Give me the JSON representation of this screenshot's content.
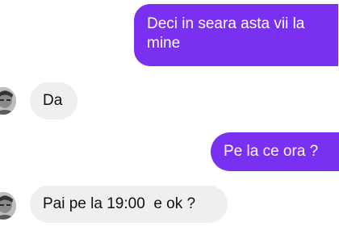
{
  "messages": [
    {
      "direction": "outgoing",
      "text": "Deci in seara asta vii la mine"
    },
    {
      "direction": "incoming",
      "text": "Da"
    },
    {
      "direction": "outgoing",
      "text": "Pe la ce ora ?"
    },
    {
      "direction": "incoming",
      "text": "Pai pe la 19:00  e ok ?"
    }
  ],
  "colors": {
    "outgoing_bubble": "#7a30f0",
    "incoming_bubble": "#efefef"
  },
  "avatar_icon": "contact-avatar-icon"
}
